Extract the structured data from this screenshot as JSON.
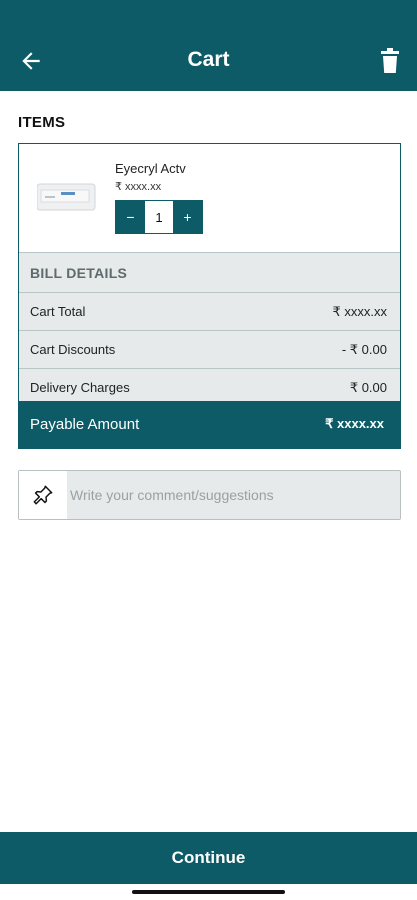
{
  "header": {
    "title": "Cart",
    "back_icon": "arrow-left-icon",
    "delete_icon": "trash-icon",
    "color": "#0d5b66"
  },
  "items_section": {
    "title": "ITEMS",
    "items": [
      {
        "name": "Eyecryl Actv",
        "price": "₹  xxxx.xx",
        "quantity": "1",
        "decrement_label": "−",
        "increment_label": "+"
      }
    ]
  },
  "bill": {
    "title": "BILL DETAILS",
    "rows": [
      {
        "label": "Cart Total",
        "value": "₹ xxxx.xx"
      },
      {
        "label": "Cart Discounts",
        "value": "- ₹ 0.00"
      },
      {
        "label": "Delivery Charges",
        "value": "₹ 0.00"
      }
    ],
    "payable_label": "Payable Amount",
    "payable_value": "₹  xxxx.xx"
  },
  "comment": {
    "placeholder": "Write your comment/suggestions",
    "value": "",
    "icon": "pin-icon"
  },
  "footer": {
    "continue_label": "Continue"
  }
}
